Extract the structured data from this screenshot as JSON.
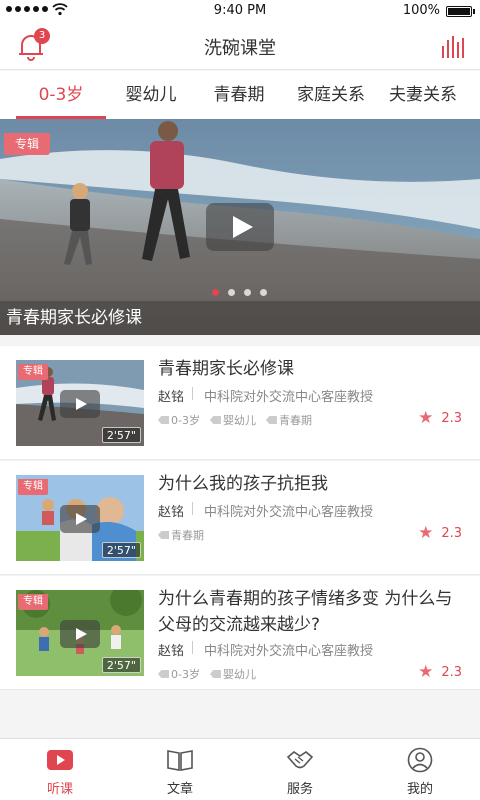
{
  "status": {
    "time": "9:40 PM",
    "battery": "100%"
  },
  "app": {
    "title": "洗碗课堂",
    "notifications": "3"
  },
  "tabs": [
    {
      "label": "0-3岁",
      "active": true
    },
    {
      "label": "婴幼儿",
      "active": false
    },
    {
      "label": "青春期",
      "active": false
    },
    {
      "label": "家庭关系",
      "active": false
    },
    {
      "label": "夫妻关系",
      "active": false
    }
  ],
  "banner": {
    "tag": "专辑",
    "caption": "青春期家长必修课",
    "slides": 4,
    "active_slide": 1
  },
  "items": [
    {
      "tag": "专辑",
      "duration": "2'57\"",
      "title": "青春期家长必修课",
      "author": "赵铭",
      "org": "中科院对外交流中心客座教授",
      "tags": [
        "0-3岁",
        "婴幼儿",
        "青春期"
      ],
      "rating": "2.3"
    },
    {
      "tag": "专辑",
      "duration": "2'57\"",
      "title": "为什么我的孩子抗拒我",
      "author": "赵铭",
      "org": "中科院对外交流中心客座教授",
      "tags": [
        "青春期"
      ],
      "rating": "2.3"
    },
    {
      "tag": "专辑",
      "duration": "2'57\"",
      "title": "为什么青春期的孩子情绪多变 为什么与父母的交流越来越少?",
      "author": "赵铭",
      "org": "中科院对外交流中心客座教授",
      "tags": [
        "0-3岁",
        "婴幼儿"
      ],
      "rating": "2.3"
    }
  ],
  "tabbar": [
    {
      "label": "听课",
      "icon": "play-icon",
      "active": true
    },
    {
      "label": "文章",
      "icon": "book-icon",
      "active": false
    },
    {
      "label": "服务",
      "icon": "handshake-icon",
      "active": false
    },
    {
      "label": "我的",
      "icon": "user-icon",
      "active": false
    }
  ],
  "colors": {
    "accent": "#e0464f",
    "tag": "#e86a72"
  }
}
